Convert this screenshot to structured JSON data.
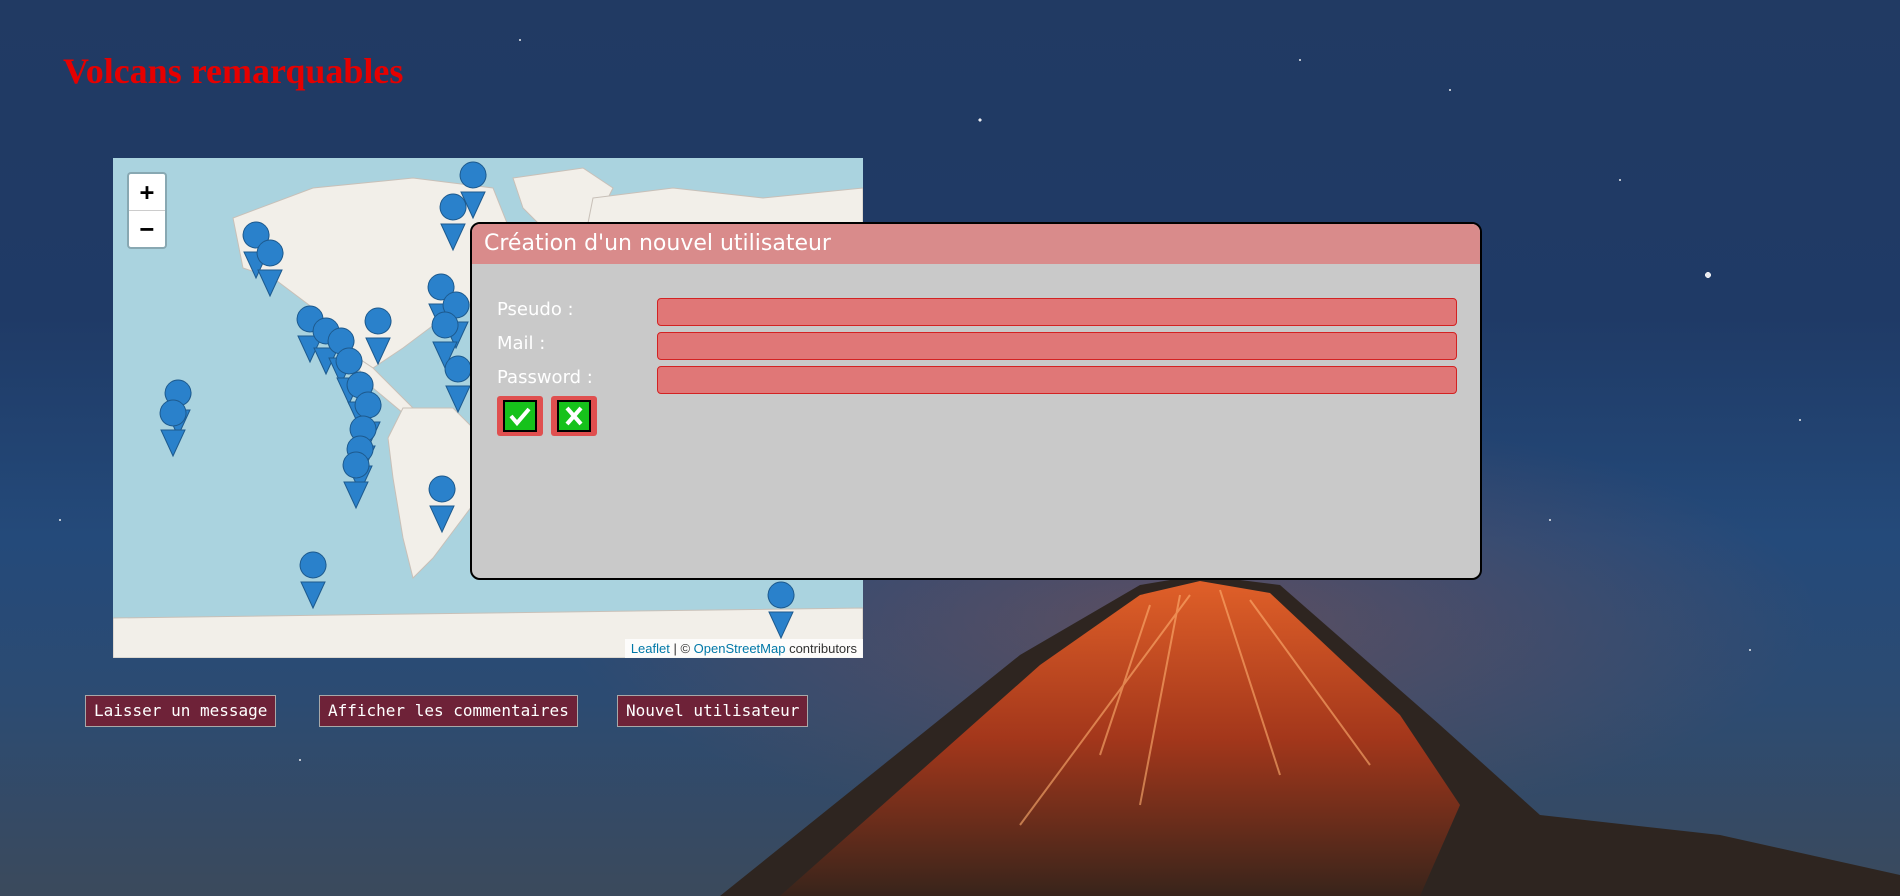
{
  "page": {
    "title": "Volcans remarquables"
  },
  "map": {
    "zoom_in_label": "+",
    "zoom_out_label": "−",
    "attribution": {
      "leaflet": "Leaflet",
      "separator": " | © ",
      "osm": "OpenStreetMap",
      "suffix": " contributors"
    },
    "marker_icon": "map-marker-icon"
  },
  "actions": {
    "leave_message": "Laisser un message",
    "show_comments": "Afficher les commentaires",
    "new_user": "Nouvel utilisateur"
  },
  "dialog": {
    "title": "Création d'un nouvel utilisateur",
    "fields": {
      "pseudo_label": "Pseudo :",
      "mail_label": "Mail :",
      "password_label": "Password :"
    },
    "confirm_icon": "checkmark-icon",
    "cancel_icon": "close-icon"
  },
  "colors": {
    "title": "#e60000",
    "dialog_header": "#d98b8b",
    "input_bg": "#e07777",
    "button_bg": "#6e2238",
    "icon_green": "#16c21b"
  }
}
